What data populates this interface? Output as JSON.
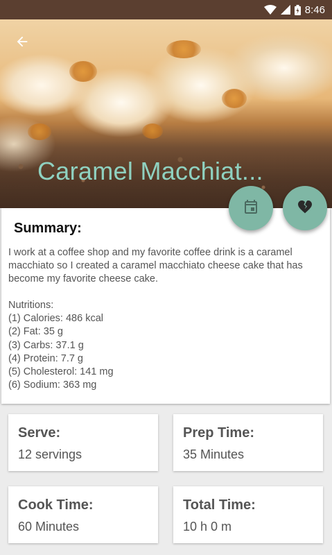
{
  "status_bar": {
    "time": "8:46"
  },
  "recipe": {
    "title": "Caramel Macchiat...",
    "summary_heading": "Summary:",
    "summary_text": "I work at a coffee shop and my favorite coffee drink is a caramel macchiato so I created a caramel macchiato cheese cake that has become my favorite cheese cake.",
    "nutrition_heading": "Nutritions:",
    "nutrition": [
      "(1) Calories: 486 kcal",
      "(2) Fat: 35 g",
      "(3) Carbs: 37.1 g",
      "(4) Protein: 7.7 g",
      "(5) Cholesterol: 141 mg",
      "(6) Sodium: 363 mg"
    ]
  },
  "info_cards": {
    "serve": {
      "label": "Serve:",
      "value": "12 servings"
    },
    "prep": {
      "label": "Prep Time:",
      "value": "35 Minutes"
    },
    "cook": {
      "label": "Cook Time:",
      "value": "60 Minutes"
    },
    "total": {
      "label": "Total Time:",
      "value": "10 h 0 m"
    }
  },
  "icons": {
    "back": "arrow-back-icon",
    "calendar": "calendar-icon",
    "heart": "broken-heart-icon",
    "wifi": "wifi-icon",
    "signal": "signal-icon",
    "battery": "battery-icon"
  },
  "colors": {
    "title": "#8fd1c0",
    "fab": "#7fb7a5",
    "status_bar": "#5b3f30"
  }
}
